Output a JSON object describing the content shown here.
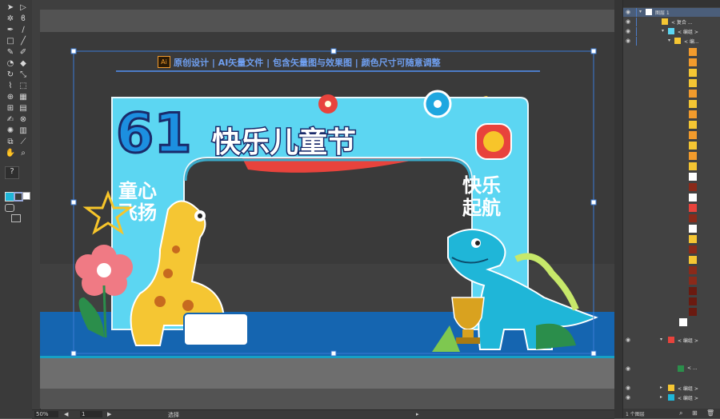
{
  "app": {
    "zoom": "50%",
    "artboard_number": "1",
    "status_tool": "选择",
    "layers_count": "1 个图层"
  },
  "banner": {
    "ai_badge": "Ai",
    "text": "原创设计 | AI矢量文件 | 包含矢量图与效果图 | 颜色尺寸可随意调整"
  },
  "artwork": {
    "big_number": "61",
    "title": "快乐儿童节",
    "left_text_top": "童心",
    "left_text_bottom": "飞扬",
    "right_text_top": "快乐",
    "right_text_bottom": "起航"
  },
  "colors": {
    "arch": "#5cd6f2",
    "stage_blue": "#1565b0",
    "floor_gray": "#6e6e6e",
    "selection": "#3a7bd5",
    "giraffe": "#f5c633",
    "dino": "#1fb6d8",
    "flower_pink": "#f07a84",
    "ribbon_red": "#e8433c",
    "ribbon_yellow": "#f7c52a",
    "leaf_green": "#2b8e4b"
  },
  "layers": {
    "top_layer": "图层 1",
    "rows": [
      {
        "name": "< 复合 ..."
      },
      {
        "name": "< 编组 >"
      },
      {
        "name": "< 编..."
      },
      {
        "name": "< 编组 >"
      },
      {
        "name": "< ..."
      },
      {
        "name": "< 编组 >"
      },
      {
        "name": "< 编组 >"
      }
    ]
  }
}
